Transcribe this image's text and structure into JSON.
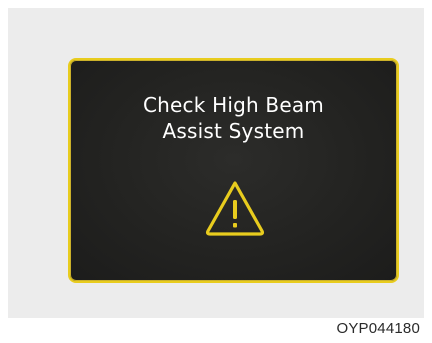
{
  "display": {
    "message_line_1": "Check High Beam",
    "message_line_2": "Assist System",
    "warning_icon": "warning-triangle-icon",
    "text_color": "#ffffff",
    "border_color": "#e8cc1e",
    "icon_color": "#e8cc1e"
  },
  "caption": "OYP044180"
}
